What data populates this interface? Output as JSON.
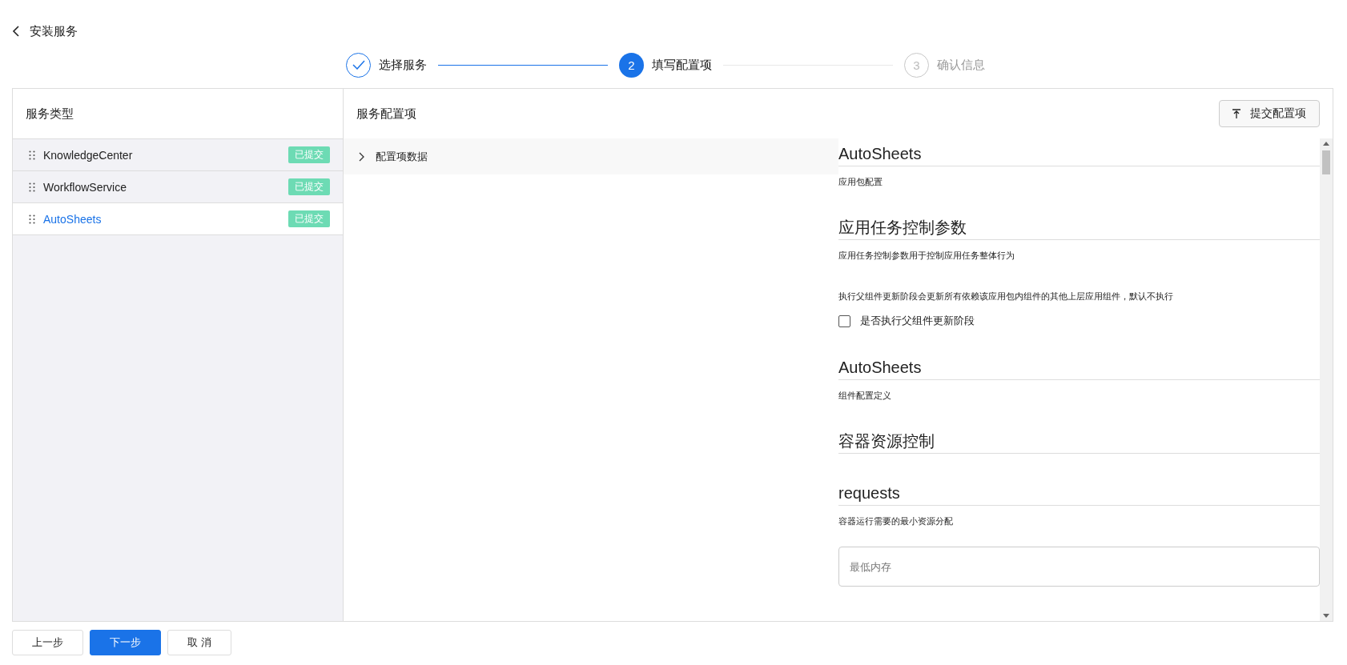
{
  "header": {
    "back_label": "安装服务"
  },
  "steps": [
    {
      "label": "选择服务",
      "completed": true,
      "current": false
    },
    {
      "number": "2",
      "label": "填写配置项",
      "completed": false,
      "current": true
    },
    {
      "number": "3",
      "label": "确认信息",
      "completed": false,
      "current": false
    }
  ],
  "service_types": {
    "title": "服务类型",
    "items": [
      {
        "name": "KnowledgeCenter",
        "badge": "已提交",
        "selected": false
      },
      {
        "name": "WorkflowService",
        "badge": "已提交",
        "selected": false
      },
      {
        "name": "AutoSheets",
        "badge": "已提交",
        "selected": true
      }
    ]
  },
  "config": {
    "title": "服务配置项",
    "submit_button": "提交配置项",
    "tree": [
      {
        "label": "配置项数据",
        "expanded": false
      }
    ],
    "form": [
      {
        "kind": "heading",
        "text": "AutoSheets"
      },
      {
        "kind": "desc",
        "text": "应用包配置"
      },
      {
        "kind": "heading",
        "text": "应用任务控制参数"
      },
      {
        "kind": "desc",
        "text": "应用任务控制参数用于控制应用任务整体行为"
      },
      {
        "kind": "help",
        "text": "执行父组件更新阶段会更新所有依赖该应用包内组件的其他上层应用组件，默认不执行"
      },
      {
        "kind": "checkbox",
        "text": "是否执行父组件更新阶段",
        "checked": false
      },
      {
        "kind": "heading",
        "text": "AutoSheets"
      },
      {
        "kind": "desc",
        "text": "组件配置定义"
      },
      {
        "kind": "heading",
        "text": "容器资源控制"
      },
      {
        "kind": "heading",
        "text": "requests"
      },
      {
        "kind": "desc",
        "text": "容器运行需要的最小资源分配"
      },
      {
        "kind": "input",
        "placeholder": "最低内存"
      }
    ]
  },
  "footer": {
    "buttons": [
      {
        "label": "上一步",
        "primary": false
      },
      {
        "label": "下一步",
        "primary": true
      },
      {
        "label": "取 消",
        "primary": false
      }
    ]
  }
}
